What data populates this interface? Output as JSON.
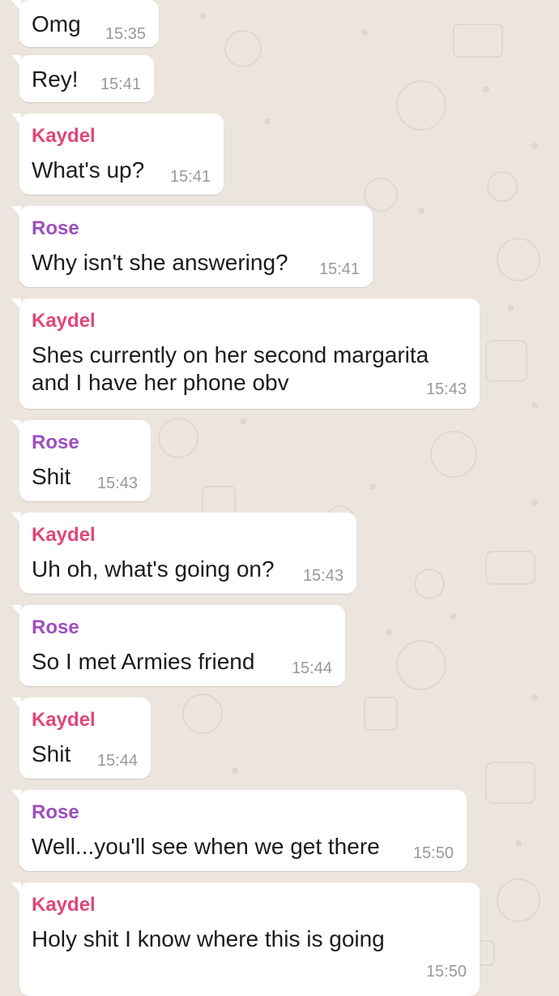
{
  "colors": {
    "kaydel": "#e0467b",
    "rose": "#9c4fbf",
    "time": "#999999",
    "bubble": "#ffffff",
    "background": "#ece5dd"
  },
  "messages": [
    {
      "sender": "",
      "lines": [
        "Omg"
      ],
      "time": "15:35"
    },
    {
      "sender": "",
      "lines": [
        "Rey!"
      ],
      "time": "15:41"
    },
    {
      "sender": "Kaydel",
      "lines": [
        "What's up?"
      ],
      "time": "15:41"
    },
    {
      "sender": "Rose",
      "lines": [
        "Why isn't she answering?"
      ],
      "time": "15:41"
    },
    {
      "sender": "Kaydel",
      "lines": [
        "Shes currently on her second margarita",
        "and I have her phone obv"
      ],
      "time": "15:43"
    },
    {
      "sender": "Rose",
      "lines": [
        "Shit"
      ],
      "time": "15:43"
    },
    {
      "sender": "Kaydel",
      "lines": [
        "Uh oh, what's going on?"
      ],
      "time": "15:43"
    },
    {
      "sender": "Rose",
      "lines": [
        "So I met Armies friend"
      ],
      "time": "15:44"
    },
    {
      "sender": "Kaydel",
      "lines": [
        "Shit"
      ],
      "time": "15:44"
    },
    {
      "sender": "Rose",
      "lines": [
        "Well...you'll see when we get there"
      ],
      "time": "15:50"
    },
    {
      "sender": "Kaydel",
      "lines": [
        "Holy shit I know where this is going"
      ],
      "time": "15:50"
    }
  ]
}
